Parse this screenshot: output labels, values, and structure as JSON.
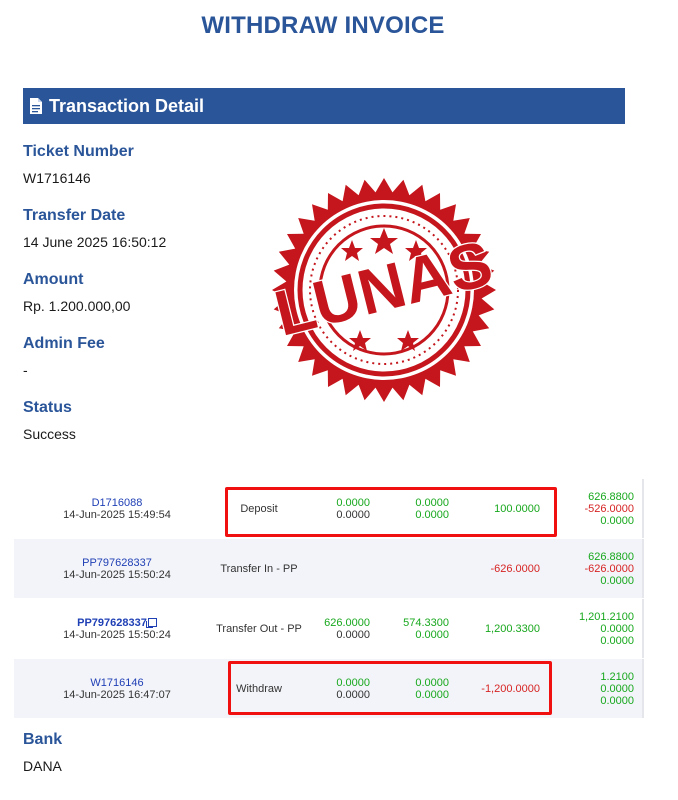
{
  "header": {
    "title": "WITHDRAW INVOICE"
  },
  "section": {
    "title": "Transaction Detail",
    "icon": "document-icon"
  },
  "fields": {
    "ticket_label": "Ticket Number",
    "ticket_value": "W1716146",
    "date_label": "Transfer Date",
    "date_value": "14 June 2025 16:50:12",
    "amount_label": "Amount",
    "amount_value": "Rp. 1.200.000,00",
    "fee_label": "Admin Fee",
    "fee_value": "-",
    "status_label": "Status",
    "status_value": "Success",
    "bank_label": "Bank",
    "bank_value": "DANA"
  },
  "stamp": {
    "text": "LUNAS",
    "color": "#c4161c"
  },
  "transactions": [
    {
      "code": "D1716088",
      "datetime": "14-Jun-2025 15:49:54",
      "type": "Deposit",
      "a1": "0.0000",
      "a2": "0.0000",
      "b1": "0.0000",
      "b2": "0.0000",
      "c1": "100.0000",
      "d1": "626.8800",
      "d2": "-526.0000",
      "d3": "0.0000"
    },
    {
      "code": "PP797628337",
      "datetime": "14-Jun-2025 15:50:24",
      "type": "Transfer In - PP",
      "c1": "-626.0000",
      "d1": "626.8800",
      "d2": "-626.0000",
      "d3": "0.0000"
    },
    {
      "code": "PP797628337",
      "datetime": "14-Jun-2025 15:50:24",
      "type": "Transfer Out - PP",
      "a1": "626.0000",
      "a2": "0.0000",
      "b1": "574.3300",
      "b2": "0.0000",
      "c1": "1,200.3300",
      "d1": "1,201.2100",
      "d2": "0.0000",
      "d3": "0.0000"
    },
    {
      "code": "W1716146",
      "datetime": "14-Jun-2025 16:47:07",
      "type": "Withdraw",
      "a1": "0.0000",
      "a2": "0.0000",
      "b1": "0.0000",
      "b2": "0.0000",
      "c1": "-1,200.0000",
      "d1": "1.2100",
      "d2": "0.0000",
      "d3": "0.0000"
    }
  ],
  "colors": {
    "brand": "#2a5599",
    "positive": "#18a81e",
    "negative": "#d62424",
    "highlight": "#f01010"
  }
}
